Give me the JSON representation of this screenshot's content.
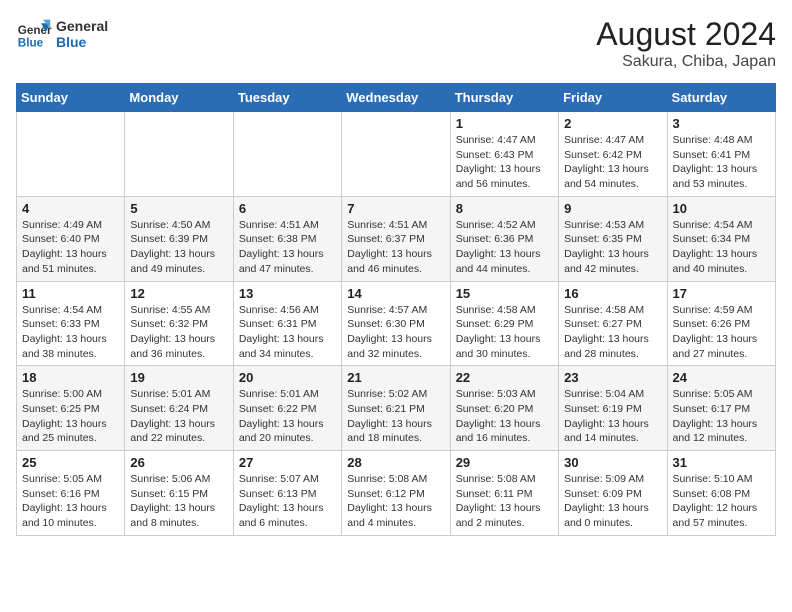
{
  "logo": {
    "line1": "General",
    "line2": "Blue"
  },
  "title": "August 2024",
  "subtitle": "Sakura, Chiba, Japan",
  "weekdays": [
    "Sunday",
    "Monday",
    "Tuesday",
    "Wednesday",
    "Thursday",
    "Friday",
    "Saturday"
  ],
  "weeks": [
    [
      {
        "day": "",
        "info": ""
      },
      {
        "day": "",
        "info": ""
      },
      {
        "day": "",
        "info": ""
      },
      {
        "day": "",
        "info": ""
      },
      {
        "day": "1",
        "info": "Sunrise: 4:47 AM\nSunset: 6:43 PM\nDaylight: 13 hours\nand 56 minutes."
      },
      {
        "day": "2",
        "info": "Sunrise: 4:47 AM\nSunset: 6:42 PM\nDaylight: 13 hours\nand 54 minutes."
      },
      {
        "day": "3",
        "info": "Sunrise: 4:48 AM\nSunset: 6:41 PM\nDaylight: 13 hours\nand 53 minutes."
      }
    ],
    [
      {
        "day": "4",
        "info": "Sunrise: 4:49 AM\nSunset: 6:40 PM\nDaylight: 13 hours\nand 51 minutes."
      },
      {
        "day": "5",
        "info": "Sunrise: 4:50 AM\nSunset: 6:39 PM\nDaylight: 13 hours\nand 49 minutes."
      },
      {
        "day": "6",
        "info": "Sunrise: 4:51 AM\nSunset: 6:38 PM\nDaylight: 13 hours\nand 47 minutes."
      },
      {
        "day": "7",
        "info": "Sunrise: 4:51 AM\nSunset: 6:37 PM\nDaylight: 13 hours\nand 46 minutes."
      },
      {
        "day": "8",
        "info": "Sunrise: 4:52 AM\nSunset: 6:36 PM\nDaylight: 13 hours\nand 44 minutes."
      },
      {
        "day": "9",
        "info": "Sunrise: 4:53 AM\nSunset: 6:35 PM\nDaylight: 13 hours\nand 42 minutes."
      },
      {
        "day": "10",
        "info": "Sunrise: 4:54 AM\nSunset: 6:34 PM\nDaylight: 13 hours\nand 40 minutes."
      }
    ],
    [
      {
        "day": "11",
        "info": "Sunrise: 4:54 AM\nSunset: 6:33 PM\nDaylight: 13 hours\nand 38 minutes."
      },
      {
        "day": "12",
        "info": "Sunrise: 4:55 AM\nSunset: 6:32 PM\nDaylight: 13 hours\nand 36 minutes."
      },
      {
        "day": "13",
        "info": "Sunrise: 4:56 AM\nSunset: 6:31 PM\nDaylight: 13 hours\nand 34 minutes."
      },
      {
        "day": "14",
        "info": "Sunrise: 4:57 AM\nSunset: 6:30 PM\nDaylight: 13 hours\nand 32 minutes."
      },
      {
        "day": "15",
        "info": "Sunrise: 4:58 AM\nSunset: 6:29 PM\nDaylight: 13 hours\nand 30 minutes."
      },
      {
        "day": "16",
        "info": "Sunrise: 4:58 AM\nSunset: 6:27 PM\nDaylight: 13 hours\nand 28 minutes."
      },
      {
        "day": "17",
        "info": "Sunrise: 4:59 AM\nSunset: 6:26 PM\nDaylight: 13 hours\nand 27 minutes."
      }
    ],
    [
      {
        "day": "18",
        "info": "Sunrise: 5:00 AM\nSunset: 6:25 PM\nDaylight: 13 hours\nand 25 minutes."
      },
      {
        "day": "19",
        "info": "Sunrise: 5:01 AM\nSunset: 6:24 PM\nDaylight: 13 hours\nand 22 minutes."
      },
      {
        "day": "20",
        "info": "Sunrise: 5:01 AM\nSunset: 6:22 PM\nDaylight: 13 hours\nand 20 minutes."
      },
      {
        "day": "21",
        "info": "Sunrise: 5:02 AM\nSunset: 6:21 PM\nDaylight: 13 hours\nand 18 minutes."
      },
      {
        "day": "22",
        "info": "Sunrise: 5:03 AM\nSunset: 6:20 PM\nDaylight: 13 hours\nand 16 minutes."
      },
      {
        "day": "23",
        "info": "Sunrise: 5:04 AM\nSunset: 6:19 PM\nDaylight: 13 hours\nand 14 minutes."
      },
      {
        "day": "24",
        "info": "Sunrise: 5:05 AM\nSunset: 6:17 PM\nDaylight: 13 hours\nand 12 minutes."
      }
    ],
    [
      {
        "day": "25",
        "info": "Sunrise: 5:05 AM\nSunset: 6:16 PM\nDaylight: 13 hours\nand 10 minutes."
      },
      {
        "day": "26",
        "info": "Sunrise: 5:06 AM\nSunset: 6:15 PM\nDaylight: 13 hours\nand 8 minutes."
      },
      {
        "day": "27",
        "info": "Sunrise: 5:07 AM\nSunset: 6:13 PM\nDaylight: 13 hours\nand 6 minutes."
      },
      {
        "day": "28",
        "info": "Sunrise: 5:08 AM\nSunset: 6:12 PM\nDaylight: 13 hours\nand 4 minutes."
      },
      {
        "day": "29",
        "info": "Sunrise: 5:08 AM\nSunset: 6:11 PM\nDaylight: 13 hours\nand 2 minutes."
      },
      {
        "day": "30",
        "info": "Sunrise: 5:09 AM\nSunset: 6:09 PM\nDaylight: 13 hours\nand 0 minutes."
      },
      {
        "day": "31",
        "info": "Sunrise: 5:10 AM\nSunset: 6:08 PM\nDaylight: 12 hours\nand 57 minutes."
      }
    ]
  ]
}
